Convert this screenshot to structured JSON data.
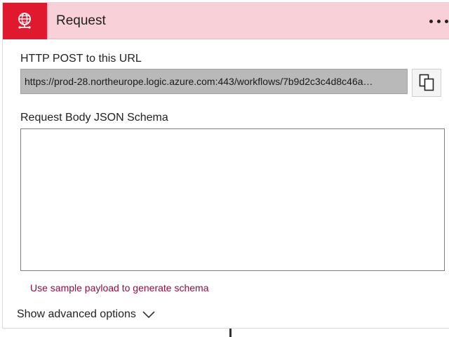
{
  "header": {
    "title": "Request",
    "icon": "globe-request-icon",
    "more_icon": "more-options-icon",
    "accent_color": "#e0192f",
    "header_color": "#f8d1d8"
  },
  "url_section": {
    "label": "HTTP POST to this URL",
    "value": "https://prod-28.northeurope.logic.azure.com:443/workflows/7b9d2c3c4d8c46a…",
    "copy_icon": "copy-icon"
  },
  "schema_section": {
    "label": "Request Body JSON Schema",
    "value": ""
  },
  "sample_link": {
    "label": "Use sample payload to generate schema",
    "color": "#8a1046"
  },
  "advanced": {
    "label": "Show advanced options",
    "icon": "chevron-down-icon"
  }
}
